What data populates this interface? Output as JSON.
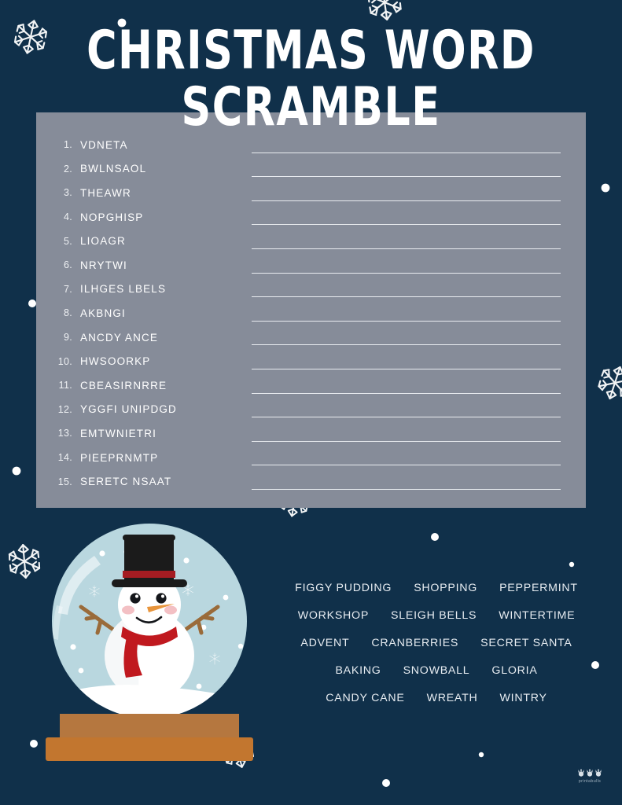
{
  "page": {
    "title": "CHRISTMAS WORD SCRAMBLE",
    "background_color": "#10304a",
    "panel_color": "#868c99"
  },
  "scramble": {
    "items": [
      {
        "number": "1.",
        "word": "VDNETA"
      },
      {
        "number": "2.",
        "word": "BWLNSAOL"
      },
      {
        "number": "3.",
        "word": "THEAWR"
      },
      {
        "number": "4.",
        "word": "NOPGHISP"
      },
      {
        "number": "5.",
        "word": "LIOAGR"
      },
      {
        "number": "6.",
        "word": "NRYTWI"
      },
      {
        "number": "7.",
        "word": "ILHGES LBELS"
      },
      {
        "number": "8.",
        "word": "AKBNGI"
      },
      {
        "number": "9.",
        "word": "ANCDY ANCE"
      },
      {
        "number": "10.",
        "word": "HWSOORKP"
      },
      {
        "number": "11.",
        "word": "CBEASIRNRRE"
      },
      {
        "number": "12.",
        "word": "YGGFI UNIPDGD"
      },
      {
        "number": "13.",
        "word": "EMTWNIETRI"
      },
      {
        "number": "14.",
        "word": "PIEEPRNMTP"
      },
      {
        "number": "15.",
        "word": "SERETC NSAAT"
      }
    ]
  },
  "word_bank": {
    "rows": [
      [
        "FIGGY PUDDING",
        "SHOPPING",
        "PEPPERMINT"
      ],
      [
        "WORKSHOP",
        "SLEIGH BELLS",
        "WINTERTIME"
      ],
      [
        "ADVENT",
        "CRANBERRIES",
        "SECRET SANTA"
      ],
      [
        "BAKING",
        "SNOWBALL",
        "GLORIA"
      ],
      [
        "CANDY CANE",
        "WREATH",
        "WINTRY"
      ]
    ]
  },
  "illustration": {
    "name": "snow-globe-with-snowman",
    "globe_color": "#b8d8e0",
    "base_top_color": "#b5773f",
    "base_bottom_color": "#c2762f",
    "hat_color": "#1b1b1b",
    "hat_band_color": "#a51c22",
    "scarf_color": "#c0191f",
    "nose_color": "#e8953c",
    "arm_color": "#9a6b3a"
  },
  "logo": {
    "text": "printabulls"
  }
}
